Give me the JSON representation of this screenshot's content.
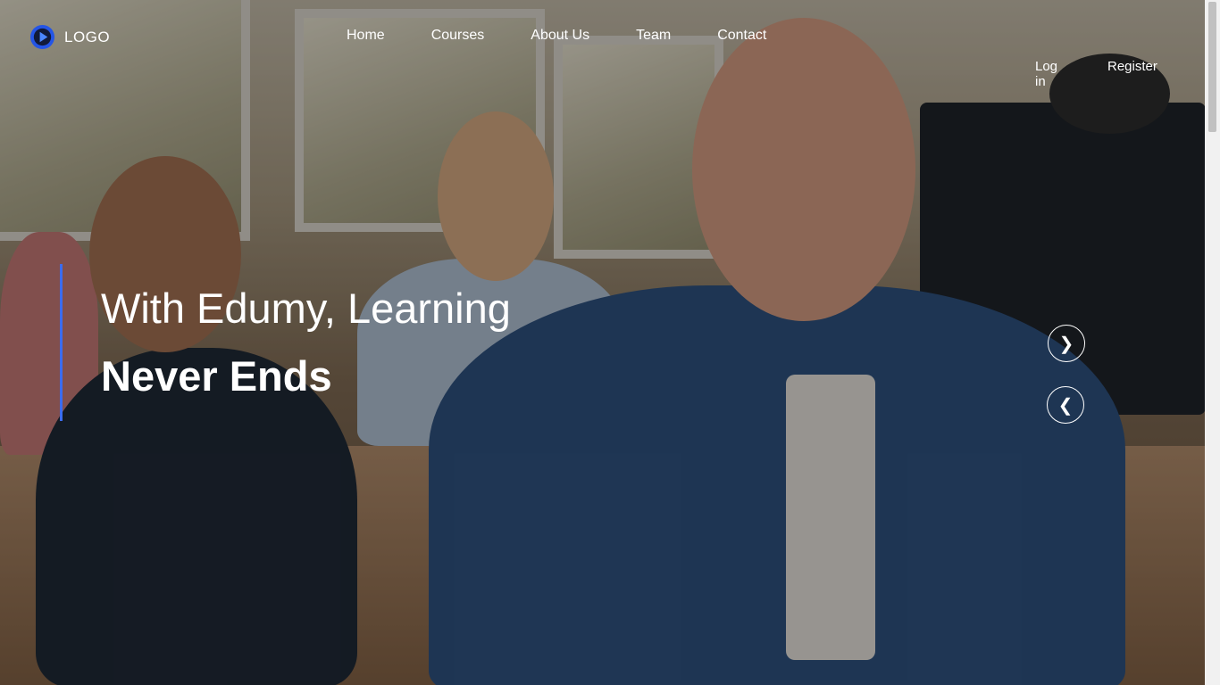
{
  "header": {
    "logo_text": "LOGO",
    "logo_icon": "play-circle-icon",
    "nav": [
      {
        "label": "Home"
      },
      {
        "label": "Courses"
      },
      {
        "label": "About Us"
      },
      {
        "label": "Team"
      },
      {
        "label": "Contact"
      }
    ],
    "login_label": "Log in",
    "register_label": "Register"
  },
  "hero": {
    "headline_line1": "With Edumy, Learning",
    "headline_line2": "Never Ends",
    "accent_color": "#3a6cf0",
    "next_icon": "chevron-right-icon",
    "prev_icon": "chevron-left-icon",
    "next_glyph": "❯",
    "prev_glyph": "❮"
  }
}
